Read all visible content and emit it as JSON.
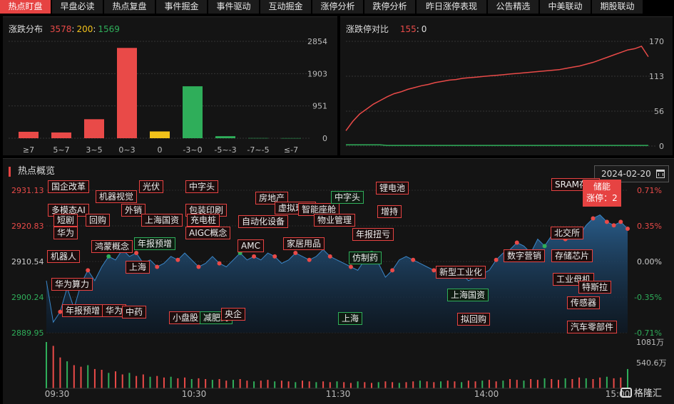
{
  "tabs": [
    "热点盯盘",
    "早盘必读",
    "热点复盘",
    "事件掘金",
    "事件驱动",
    "互动掘金",
    "涨停分析",
    "跌停分析",
    "昨日涨停表现",
    "公告精选",
    "中美联动",
    "期股联动"
  ],
  "active_tab": 0,
  "dist": {
    "title": "涨跌分布",
    "up": "3578",
    "flat": "200",
    "down": "1569",
    "yticks": [
      "2854",
      "1903",
      "951",
      "0"
    ],
    "chart_data": {
      "type": "bar",
      "categories": [
        "≥7",
        "5~7",
        "3~5",
        "0~3",
        "0",
        "-3~0",
        "-5~-3",
        "-7~-5",
        "≤-7"
      ],
      "values": [
        190,
        170,
        560,
        2660,
        200,
        1530,
        60,
        5,
        3
      ],
      "colors": [
        "#e94a48",
        "#e94a48",
        "#e94a48",
        "#e94a48",
        "#f2c21a",
        "#2fae5a",
        "#2fae5a",
        "#2fae5a",
        "#2fae5a"
      ],
      "ylim": [
        0,
        2854
      ]
    }
  },
  "limit": {
    "title": "涨跌停对比",
    "up": "155",
    "down": "0",
    "yticks": [
      "170",
      "113",
      "56",
      "0"
    ],
    "chart_data": {
      "type": "line",
      "ylim": [
        0,
        170
      ],
      "series": [
        {
          "values": [
            25,
            40,
            52,
            60,
            68,
            74,
            80,
            85,
            88,
            92,
            95,
            98,
            100,
            103,
            105,
            107,
            108,
            110,
            111,
            112,
            113,
            114,
            115,
            116,
            117,
            118,
            119,
            120,
            121,
            122,
            123,
            124,
            126,
            128,
            130,
            133,
            136,
            140,
            144,
            148,
            152,
            156,
            158,
            162,
            145
          ]
        },
        {
          "values": [
            2,
            2,
            2,
            2,
            2,
            2,
            1,
            1,
            1,
            1,
            1,
            1,
            1,
            1,
            1,
            1,
            1,
            1,
            1,
            1,
            1,
            1,
            1,
            1,
            1,
            1,
            1,
            1,
            1,
            1,
            1,
            1,
            1,
            1,
            1,
            1,
            1,
            1,
            1,
            1,
            1,
            1,
            1,
            1,
            1
          ]
        }
      ]
    }
  },
  "hot": {
    "title": "热点概览",
    "date": "2024-02-20",
    "ylabels_left": [
      "2931.13",
      "2920.83",
      "2910.54",
      "2900.24",
      "2889.95"
    ],
    "ylabels_right": [
      "0.71%",
      "0.35%",
      "0.00%",
      "-0.35%",
      "-0.71%"
    ],
    "vol_labels": [
      "1081万",
      "540.6万"
    ],
    "time_labels": [
      "09:30",
      "10:30",
      "11:30",
      "14:00",
      "15:00"
    ],
    "popup": {
      "name": "储能",
      "line2": "涨停：2"
    },
    "logo": "格隆汇",
    "chart_data": {
      "type": "area",
      "ylim": [
        2889.95,
        2931.13
      ],
      "values": [
        2905,
        2893,
        2896,
        2903,
        2897,
        2904,
        2908,
        2905,
        2909,
        2912,
        2911,
        2914,
        2912,
        2913,
        2910,
        2911,
        2909,
        2910,
        2912,
        2911,
        2913,
        2911,
        2909,
        2910,
        2912,
        2910,
        2909,
        2911,
        2913,
        2911,
        2912,
        2911,
        2913,
        2912,
        2910,
        2911,
        2913,
        2912,
        2911,
        2912,
        2914,
        2912,
        2911,
        2910,
        2909,
        2908,
        2911,
        2913,
        2910,
        2906,
        2908,
        2911,
        2912,
        2911,
        2910,
        2909,
        2908,
        2907,
        2906,
        2908,
        2907,
        2905,
        2906,
        2907,
        2908,
        2911,
        2913,
        2914,
        2916,
        2915,
        2913,
        2917,
        2915,
        2918,
        2919,
        2917,
        2920,
        2918,
        2921,
        2923,
        2924,
        2922,
        2921,
        2922,
        2920
      ],
      "volume": [
        60,
        55,
        40,
        35,
        30,
        28,
        30,
        25,
        24,
        20,
        22,
        18,
        20,
        16,
        18,
        15,
        16,
        14,
        15,
        13,
        14,
        12,
        13,
        12,
        11,
        12,
        10,
        11,
        12,
        10,
        9,
        10,
        11,
        9,
        10,
        9,
        8,
        10,
        9,
        8,
        9,
        8,
        9,
        8,
        7,
        9,
        8,
        7,
        8,
        9,
        8,
        7,
        8,
        9,
        10,
        9,
        8,
        9,
        10,
        9,
        8,
        10,
        9,
        10,
        11,
        9,
        10,
        12,
        11,
        10,
        12,
        11,
        13,
        12,
        11,
        13,
        12,
        14,
        13,
        12,
        14,
        15,
        13,
        14,
        25
      ]
    },
    "tags": [
      {
        "label": "国企改革",
        "c": "r"
      },
      {
        "label": "机器视觉",
        "c": "r"
      },
      {
        "label": "光伏",
        "c": "r"
      },
      {
        "label": "中字头",
        "c": "r"
      },
      {
        "label": "多模态AI",
        "c": "r"
      },
      {
        "label": "外销",
        "c": "r"
      },
      {
        "label": "包装印刷",
        "c": "r"
      },
      {
        "label": "短剧",
        "c": "r"
      },
      {
        "label": "回购",
        "c": "r"
      },
      {
        "label": "上海国资",
        "c": "r"
      },
      {
        "label": "充电桩",
        "c": "r"
      },
      {
        "label": "华为",
        "c": "r"
      },
      {
        "label": "AIGC概念",
        "c": "r"
      },
      {
        "label": "鸿蒙概念",
        "c": "r"
      },
      {
        "label": "年报预增",
        "c": "g"
      },
      {
        "label": "机器人",
        "c": "r"
      },
      {
        "label": "上海",
        "c": "r"
      },
      {
        "label": "华为算力",
        "c": "r"
      },
      {
        "label": "年报预增",
        "c": "r"
      },
      {
        "label": "华为",
        "c": "r"
      },
      {
        "label": "中药",
        "c": "r"
      },
      {
        "label": "小盘股",
        "c": "r"
      },
      {
        "label": "减肥药",
        "c": "g"
      },
      {
        "label": "央企",
        "c": "r"
      },
      {
        "label": "房地产",
        "c": "r"
      },
      {
        "label": "虚拟现实",
        "c": "r"
      },
      {
        "label": "智能座舱",
        "c": "r"
      },
      {
        "label": "中字头",
        "c": "g"
      },
      {
        "label": "锂电池",
        "c": "r"
      },
      {
        "label": "增持",
        "c": "r"
      },
      {
        "label": "自动化设备",
        "c": "r"
      },
      {
        "label": "物业管理",
        "c": "r"
      },
      {
        "label": "年报扭亏",
        "c": "r"
      },
      {
        "label": "AMC",
        "c": "r"
      },
      {
        "label": "家居用品",
        "c": "r"
      },
      {
        "label": "仿制药",
        "c": "g"
      },
      {
        "label": "上海",
        "c": "g"
      },
      {
        "label": "新型工业化",
        "c": "r"
      },
      {
        "label": "上海国资",
        "c": "g"
      },
      {
        "label": "拟回购",
        "c": "r"
      },
      {
        "label": "数字营销",
        "c": "r"
      },
      {
        "label": "SRAM存储",
        "c": "r"
      },
      {
        "label": "北交所",
        "c": "r"
      },
      {
        "label": "存储芯片",
        "c": "r"
      },
      {
        "label": "工业母机",
        "c": "r"
      },
      {
        "label": "特斯拉",
        "c": "r"
      },
      {
        "label": "传感器",
        "c": "r"
      },
      {
        "label": "汽车零部件",
        "c": "r"
      }
    ]
  }
}
